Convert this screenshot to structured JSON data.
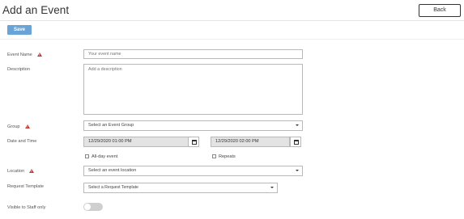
{
  "header": {
    "title": "Add an Event",
    "back_label": "Back"
  },
  "toolbar": {
    "save_label": "Save"
  },
  "form": {
    "event_name": {
      "label": "Event Name",
      "placeholder": "Your event name",
      "required": true
    },
    "description": {
      "label": "Description",
      "placeholder": "Add a description"
    },
    "group": {
      "label": "Group",
      "value": "Select an Event Group",
      "required": true
    },
    "date_time": {
      "label": "Date and Time",
      "start": "12/29/2020 01:00 PM",
      "end": "12/29/2020 02:00 PM",
      "all_day_label": "All-day event",
      "all_day_checked": false,
      "repeats_label": "Repeats",
      "repeats_checked": false
    },
    "location": {
      "label": "Location",
      "value": "Select an event location",
      "required": true
    },
    "request_template": {
      "label": "Request Template",
      "value": "Select a Request Template"
    },
    "visible_to_staff": {
      "label": "Visible to Staff only",
      "enabled": false
    }
  },
  "colors": {
    "accent": "#6aa3d6",
    "required_icon": "#c83a33",
    "toggle_off": "#cfcfcf"
  }
}
